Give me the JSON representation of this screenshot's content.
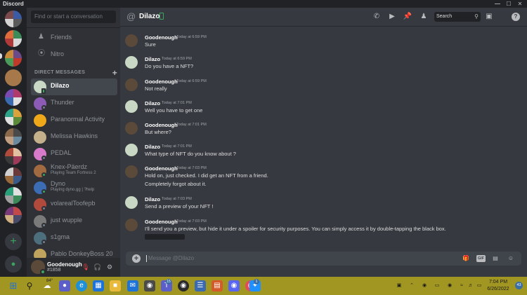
{
  "app": {
    "title": "Discord",
    "window_controls": [
      "—",
      "☐",
      "✕"
    ]
  },
  "sidebar": {
    "search_placeholder": "Find or start a conversation",
    "nav": [
      {
        "label": "Friends",
        "icon": "friends-icon"
      },
      {
        "label": "Nitro",
        "icon": "nitro-icon"
      }
    ],
    "dm_header": "DIRECT MESSAGES",
    "dm_items": [
      {
        "name": "Dilazo",
        "active": true,
        "status": "mobile",
        "color": "#c9d8c4"
      },
      {
        "name": "Thunder",
        "color": "#8c5bb5"
      },
      {
        "name": "Paranormal Activity",
        "color": "#f0a81b"
      },
      {
        "name": "Melissa Hawkins",
        "color": "#c4b08a"
      },
      {
        "name": "PEDAL",
        "color": "#d77ac9"
      },
      {
        "name": "Knex-Päerdz",
        "sub": "Playing Team Fortress 2",
        "color": "#a26a40"
      },
      {
        "name": "Dyno",
        "sub": "Playing dyno.gg | ?help",
        "color": "#3c6cb4"
      },
      {
        "name": "volarealToofepb",
        "color": "#b04a3c"
      },
      {
        "name": "just wupple",
        "color": "#7a7a7a"
      },
      {
        "name": "s1gma",
        "color": "#4d6f7d"
      },
      {
        "name": "Pablo DonkeyBoss 20",
        "color": "#c0a35d"
      }
    ]
  },
  "user_panel": {
    "name": "Goodenough",
    "tag": "#1858"
  },
  "chat": {
    "recipient": "Dilazo",
    "search_placeholder": "Search",
    "composer_placeholder": "Message @Dilazo",
    "messages": [
      {
        "author": "Goodenough",
        "time": "Today at 6:59 PM",
        "lines": [
          "Sure"
        ],
        "avatar": "goodenough"
      },
      {
        "author": "Dilazo",
        "time": "Today at 6:59 PM",
        "lines": [
          "Do you have a NFT?"
        ],
        "avatar": "dilazo"
      },
      {
        "author": "Goodenough",
        "time": "Today at 6:59 PM",
        "lines": [
          "Not really"
        ],
        "avatar": "goodenough"
      },
      {
        "author": "Dilazo",
        "time": "Today at 7:01 PM",
        "lines": [
          "Well you have to get one"
        ],
        "avatar": "dilazo"
      },
      {
        "author": "Goodenough",
        "time": "Today at 7:01 PM",
        "lines": [
          "But where?"
        ],
        "avatar": "goodenough"
      },
      {
        "author": "Dilazo",
        "time": "Today at 7:01 PM",
        "lines": [
          "What type of NFT do you know about ?"
        ],
        "avatar": "dilazo"
      },
      {
        "author": "Goodenough",
        "time": "Today at 7:03 PM",
        "lines": [
          "Hold on, just checked. I did get an NFT from a friend.",
          "Completely forgot about it."
        ],
        "avatar": "goodenough"
      },
      {
        "author": "Dilazo",
        "time": "Today at 7:03 PM",
        "lines": [
          "Send a preview of your NFT !"
        ],
        "avatar": "dilazo"
      },
      {
        "author": "Goodenough",
        "time": "Today at 7:03 PM",
        "lines": [
          "I'll send you a preview, but hide it under a spoiler for security purposes. You can simply access it by double-tapping the black box."
        ],
        "avatar": "goodenough",
        "spoiler": true
      }
    ]
  },
  "taskbar": {
    "weather_temp": "84°",
    "badges": {
      "teams": "15",
      "discord": "1"
    },
    "clock_time": "7:04 PM",
    "clock_date": "6/26/2022",
    "notification_count": "43"
  },
  "colors": {
    "accent_green": "#3ba55d",
    "taskbar": "#a29623",
    "chat_bg": "#36393f",
    "sidebar_bg": "#2f3136"
  }
}
